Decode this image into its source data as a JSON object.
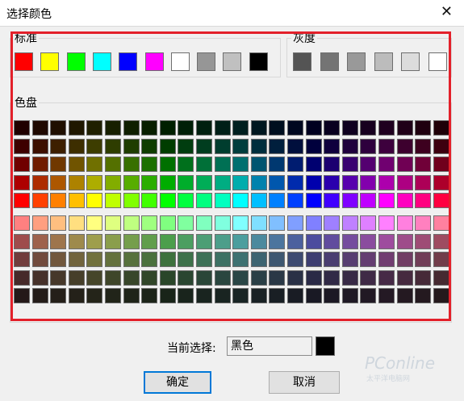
{
  "window": {
    "title": "选择颜色",
    "close_glyph": "✕"
  },
  "standard": {
    "label": "标准",
    "colors": [
      "#ff0000",
      "#ffff00",
      "#00ff00",
      "#00ffff",
      "#0000ff",
      "#ff00ff",
      "#ffffff",
      "#969696",
      "#c0c0c0",
      "#000000"
    ]
  },
  "gray": {
    "label": "灰度",
    "colors": [
      "#545454",
      "#747474",
      "#999999",
      "#bcbcbc",
      "#dcdcdc",
      "#ffffff"
    ]
  },
  "palette": {
    "label": "色盘",
    "hues": [
      0,
      15,
      30,
      45,
      60,
      75,
      90,
      105,
      120,
      135,
      150,
      165,
      180,
      195,
      210,
      225,
      240,
      255,
      270,
      285,
      300,
      315,
      330,
      345
    ],
    "rows": [
      {
        "s": 100,
        "l": 6
      },
      {
        "s": 100,
        "l": 12
      },
      {
        "s": 100,
        "l": 22
      },
      {
        "s": 100,
        "l": 34
      },
      {
        "s": 100,
        "l": 50
      },
      {
        "s": 100,
        "l": 75
      },
      {
        "s": 35,
        "l": 46
      },
      {
        "s": 30,
        "l": 34
      },
      {
        "s": 25,
        "l": 22
      },
      {
        "s": 18,
        "l": 12
      }
    ]
  },
  "current": {
    "label": "当前选择:",
    "value": "黑色",
    "color": "#000000"
  },
  "buttons": {
    "ok": "确定",
    "cancel": "取消"
  },
  "watermark": {
    "brand": "PConline",
    "sub": "太平洋电脑网"
  }
}
